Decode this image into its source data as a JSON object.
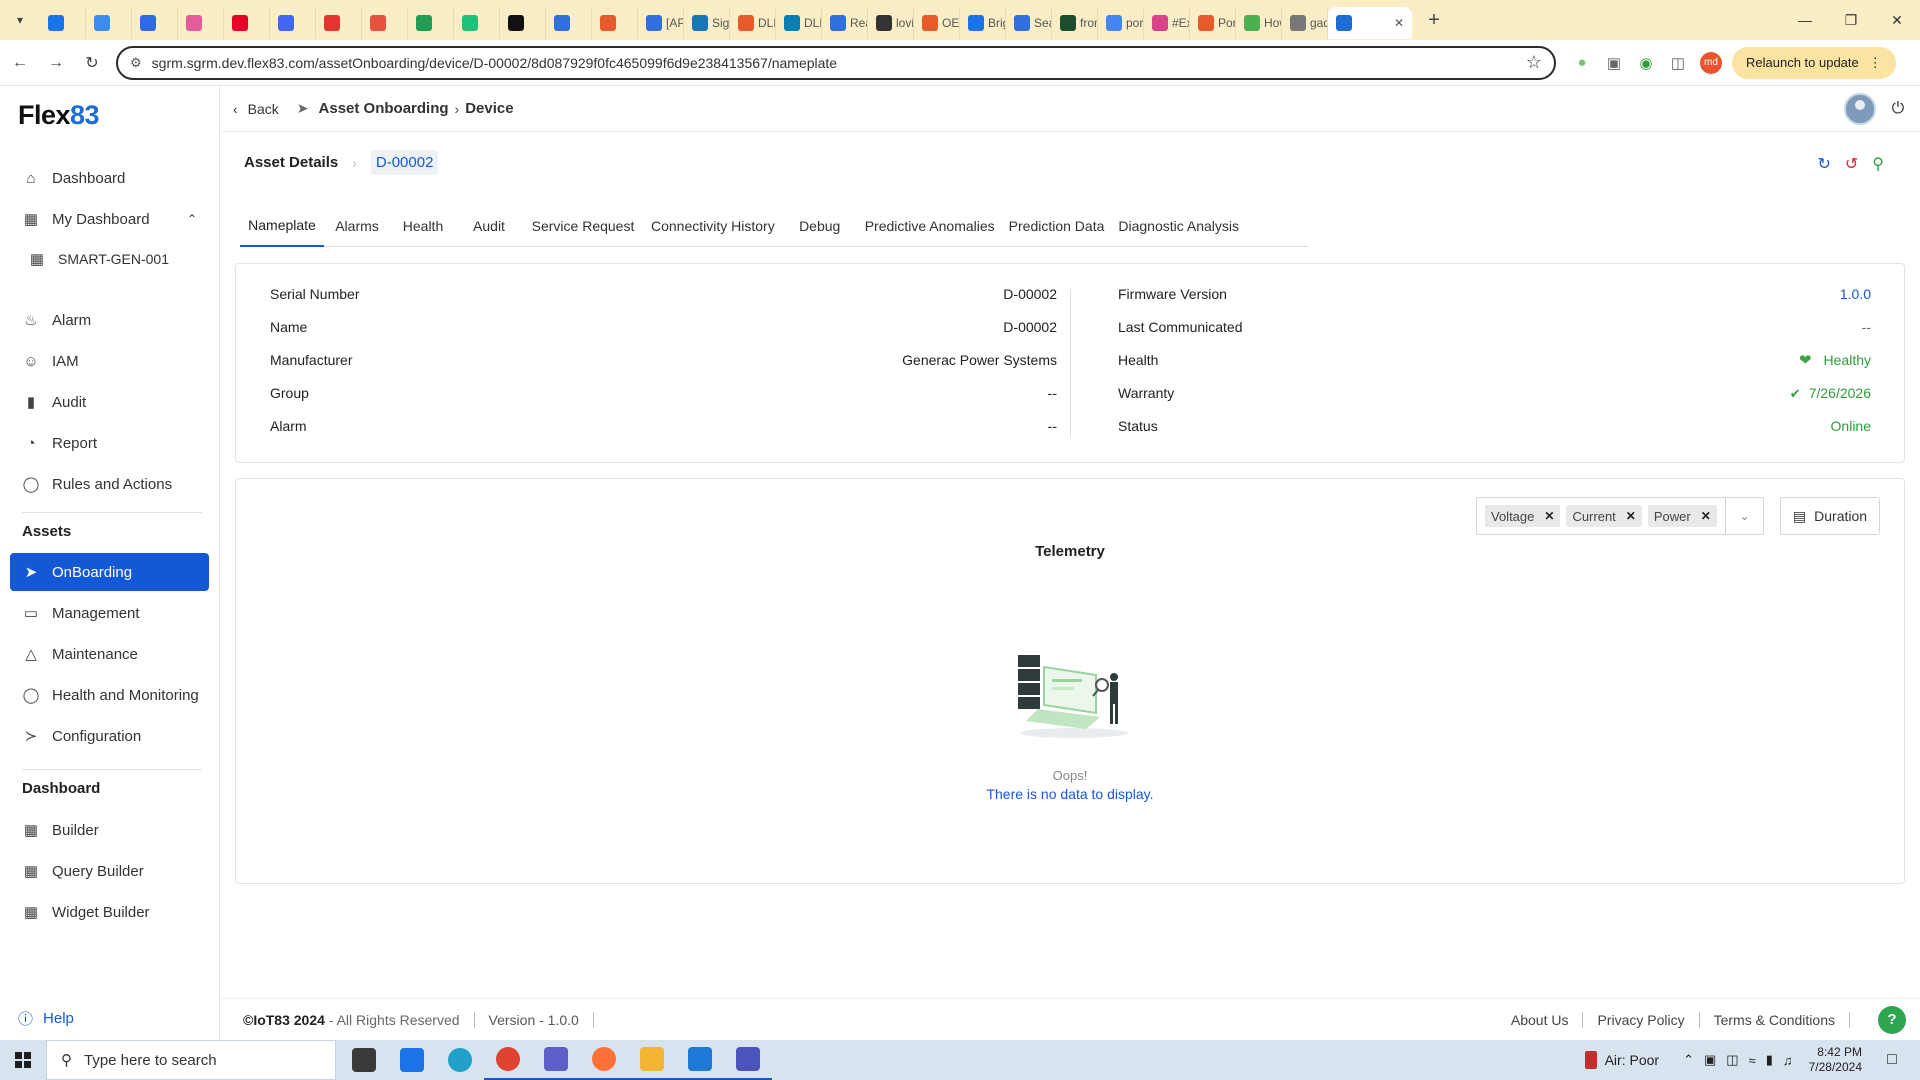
{
  "browser": {
    "tabs": [
      {
        "label": "",
        "color": "#1a73e8"
      },
      {
        "label": "",
        "color": "#3c8df0"
      },
      {
        "label": "",
        "color": "#2e6ae6"
      },
      {
        "label": "",
        "color": "#e55b9b"
      },
      {
        "label": "",
        "color": "#e60023"
      },
      {
        "label": "",
        "color": "#4166f5"
      },
      {
        "label": "",
        "color": "#e3342f"
      },
      {
        "label": "",
        "color": "#e5533d"
      },
      {
        "label": "",
        "color": "#1f9d55"
      },
      {
        "label": "",
        "color": "#21c17a"
      },
      {
        "label": "",
        "color": "#111111"
      },
      {
        "label": "",
        "color": "#2f6fde"
      },
      {
        "label": "",
        "color": "#e85a2c"
      },
      {
        "label": "[API",
        "color": "#2f6fde"
      },
      {
        "label": "Sign",
        "color": "#1877b6"
      },
      {
        "label": "DLM",
        "color": "#e85a2c"
      },
      {
        "label": "DLM",
        "color": "#0a7fb5"
      },
      {
        "label": "Reac",
        "color": "#2f6fde"
      },
      {
        "label": "lovir",
        "color": "#333333"
      },
      {
        "label": "OED",
        "color": "#e85a2c"
      },
      {
        "label": "Brig",
        "color": "#1a73e8"
      },
      {
        "label": "Sear",
        "color": "#2f6fde"
      },
      {
        "label": "from",
        "color": "#1b4d2e"
      },
      {
        "label": "port",
        "color": "#4285f4"
      },
      {
        "label": "#Exp",
        "color": "#d8468a"
      },
      {
        "label": "Port",
        "color": "#e85a2c"
      },
      {
        "label": "How",
        "color": "#4caf50"
      },
      {
        "label": "gadi",
        "color": "#777777"
      }
    ],
    "active_tab_label": "",
    "active_tab_close": "✕",
    "url": "sgrm.sgrm.dev.flex83.com/assetOnboarding/device/D-00002/8d087929f0fc465099f6d9e238413567/nameplate",
    "profile_initials": "md",
    "relaunch_label": "Relaunch to update"
  },
  "app": {
    "logo_text": "Flex",
    "logo_accent": "83",
    "nav": {
      "dashboard": "Dashboard",
      "my_dashboard": "My Dashboard",
      "smart_gen": "SMART-GEN-001",
      "alarm": "Alarm",
      "iam": "IAM",
      "audit": "Audit",
      "report": "Report",
      "rules": "Rules and Actions",
      "assets_heading": "Assets",
      "onboarding": "OnBoarding",
      "management": "Management",
      "maintenance": "Maintenance",
      "health_monitoring": "Health and Monitoring",
      "configuration": "Configuration",
      "dashboard_heading": "Dashboard",
      "builder": "Builder",
      "query_builder": "Query Builder",
      "widget_builder": "Widget Builder",
      "help": "Help"
    },
    "topbar": {
      "back_label": "Back",
      "breadcrumb_main": "Asset Onboarding",
      "breadcrumb_sub": "Device"
    },
    "asset": {
      "title": "Asset Details",
      "id": "D-00002"
    },
    "tabs": [
      "Nameplate",
      "Alarms",
      "Health",
      "Audit",
      "Service Request",
      "Connectivity History",
      "Debug",
      "Predictive Anomalies",
      "Prediction Data",
      "Diagnostic Analysis"
    ],
    "nameplate_left": [
      {
        "key": "Serial Number",
        "value": "D-00002"
      },
      {
        "key": "Name",
        "value": "D-00002"
      },
      {
        "key": "Manufacturer",
        "value": "Generac Power Systems"
      },
      {
        "key": "Group",
        "value": "--"
      },
      {
        "key": "Alarm",
        "value": "--"
      }
    ],
    "nameplate_right": [
      {
        "key": "Firmware Version",
        "value": "1.0.0"
      },
      {
        "key": "Last Communicated",
        "value": "--"
      },
      {
        "key": "Health",
        "value": "Healthy"
      },
      {
        "key": "Warranty",
        "value": "7/26/2026"
      },
      {
        "key": "Status",
        "value": "Online"
      }
    ],
    "telemetry": {
      "title": "Telemetry",
      "series_chips": [
        "Voltage",
        "Current",
        "Power"
      ],
      "duration_label": "Duration",
      "empty_oops": "Oops!",
      "empty_message": "There is no data to display."
    },
    "footer": {
      "copyright": "©IoT83 2024",
      "rights": " - All Rights Reserved",
      "version": "Version - 1.0.0",
      "about": "About Us",
      "privacy": "Privacy Policy",
      "terms": "Terms & Conditions"
    }
  },
  "taskbar": {
    "search_placeholder": "Type here to search",
    "air_quality": "Air: Poor",
    "time": "8:42 PM",
    "date": "7/28/2024",
    "apps": [
      {
        "name": "task-view",
        "color": "#3a3a3a"
      },
      {
        "name": "mail",
        "color": "#1a73e8"
      },
      {
        "name": "edge",
        "color": "#1fa0c9"
      },
      {
        "name": "chrome",
        "color": "#e0432f"
      },
      {
        "name": "teams",
        "color": "#5b5fc7"
      },
      {
        "name": "firefox",
        "color": "#ff7139"
      },
      {
        "name": "explorer",
        "color": "#f2b632"
      },
      {
        "name": "vscode",
        "color": "#1e7ad6"
      },
      {
        "name": "teams-classic",
        "color": "#4b53bc"
      }
    ]
  },
  "colors": {
    "primary": "#1558d6",
    "success": "#2e9d3a",
    "danger": "#d42b2b",
    "tabstrip": "#fbeec6"
  }
}
